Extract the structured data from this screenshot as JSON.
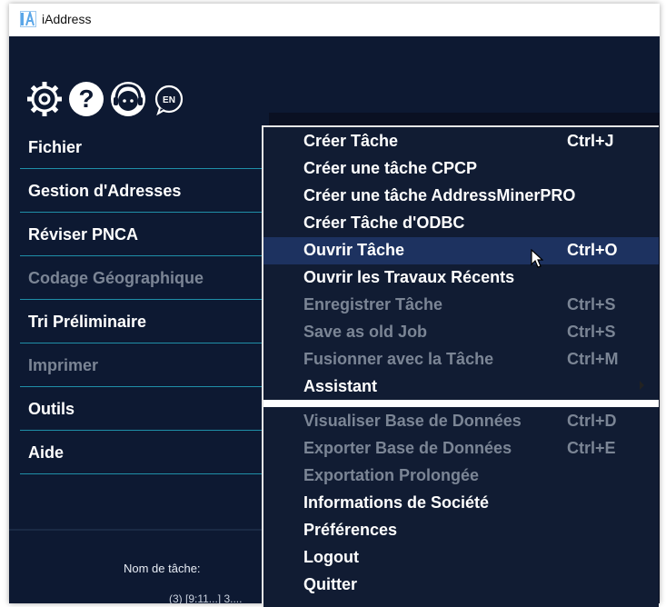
{
  "window": {
    "title": "iAddress"
  },
  "toolbar": {
    "icons": [
      "settings-gear-icon",
      "help-question-icon",
      "support-agent-icon",
      "language-en-icon"
    ],
    "language_label": "EN"
  },
  "nav": {
    "items": [
      {
        "label": "Fichier",
        "enabled": true
      },
      {
        "label": "Gestion d'Adresses",
        "enabled": true
      },
      {
        "label": "Réviser PNCA",
        "enabled": true
      },
      {
        "label": "Codage Géographique",
        "enabled": false
      },
      {
        "label": "Tri Préliminaire",
        "enabled": true
      },
      {
        "label": "Imprimer",
        "enabled": false
      },
      {
        "label": "Outils",
        "enabled": true
      },
      {
        "label": "Aide",
        "enabled": true
      }
    ]
  },
  "main": {
    "task_name_label": "Nom de tâche:",
    "bottom_text": "(3) [9:11...] 3...."
  },
  "menu": {
    "items": [
      {
        "label": "Créer Tâche",
        "shortcut": "Ctrl+J",
        "enabled": true
      },
      {
        "label": "Créer une tâche CPCP",
        "shortcut": "",
        "enabled": true
      },
      {
        "label": "Créer une tâche AddressMinerPRO",
        "shortcut": "",
        "enabled": true
      },
      {
        "label": "Créer Tâche d'ODBC",
        "shortcut": "",
        "enabled": true
      },
      {
        "label": "Ouvrir Tâche",
        "shortcut": "Ctrl+O",
        "enabled": true,
        "highlighted": true
      },
      {
        "label": "Ouvrir les Travaux Récents",
        "shortcut": "",
        "enabled": true
      },
      {
        "label": "Enregistrer Tâche",
        "shortcut": "Ctrl+S",
        "enabled": false
      },
      {
        "label": "Save as old Job",
        "shortcut": "Ctrl+S",
        "enabled": false
      },
      {
        "label": "Fusionner avec la Tâche",
        "shortcut": "Ctrl+M",
        "enabled": false
      },
      {
        "label": "Assistant",
        "shortcut": "",
        "enabled": true,
        "submenu": true
      },
      {
        "label": "Visualiser Base de Données",
        "shortcut": "Ctrl+D",
        "enabled": false
      },
      {
        "label": "Exporter Base de Données",
        "shortcut": "Ctrl+E",
        "enabled": false
      },
      {
        "label": "Exportation Prolongée",
        "shortcut": "",
        "enabled": false
      },
      {
        "label": "Informations de Société",
        "shortcut": "",
        "enabled": true
      },
      {
        "label": "Préférences",
        "shortcut": "",
        "enabled": true
      },
      {
        "label": "Logout",
        "shortcut": "",
        "enabled": true
      },
      {
        "label": "Quitter",
        "shortcut": "",
        "enabled": true
      }
    ]
  },
  "colors": {
    "background": "#0d1932",
    "menu_background": "#111c33",
    "highlight": "#1d3260",
    "divider": "#1f8fa8",
    "disabled_text": "#7b8595"
  }
}
